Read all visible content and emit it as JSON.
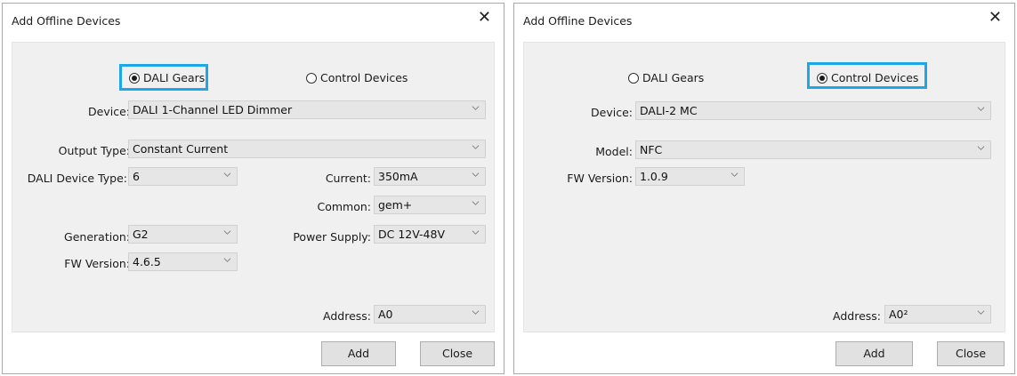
{
  "left_dialog": {
    "title": "Add Offline Devices",
    "close_glyph": "✕",
    "radio_gears": "DALI Gears",
    "radio_controls": "Control Devices",
    "selected": "DALI Gears",
    "device_label": "Device:",
    "device_value": "DALI 1-Channel LED Dimmer",
    "output_type_label": "Output Type:",
    "output_type_value": "Constant Current",
    "device_type_label": "DALI Device Type:",
    "device_type_value": "6",
    "current_label": "Current:",
    "current_value": "350mA",
    "common_label": "Common:",
    "common_value": "gem+",
    "generation_label": "Generation:",
    "generation_value": "G2",
    "power_label": "Power Supply:",
    "power_value": "DC 12V-48V",
    "fw_label": "FW Version:",
    "fw_value": "4.6.5",
    "address_label": "Address:",
    "address_value": "A0",
    "add_button": "Add",
    "close_button": "Close"
  },
  "right_dialog": {
    "title": "Add Offline Devices",
    "close_glyph": "✕",
    "radio_gears": "DALI Gears",
    "radio_controls": "Control Devices",
    "selected": "Control Devices",
    "device_label": "Device:",
    "device_value": "DALI-2 MC",
    "model_label": "Model:",
    "model_value": "NFC",
    "fw_label": "FW Version:",
    "fw_value": "1.0.9",
    "address_label": "Address:",
    "address_value": "A0²",
    "add_button": "Add",
    "close_button": "Close"
  },
  "colors": {
    "highlight": "#1ba7e8",
    "content_bg": "#f0f0f0",
    "combo_bg": "#e6e6e6",
    "button_bg": "#e1e1e1"
  },
  "icons": {
    "chevron": "chevron-down-icon",
    "close": "close-icon"
  }
}
